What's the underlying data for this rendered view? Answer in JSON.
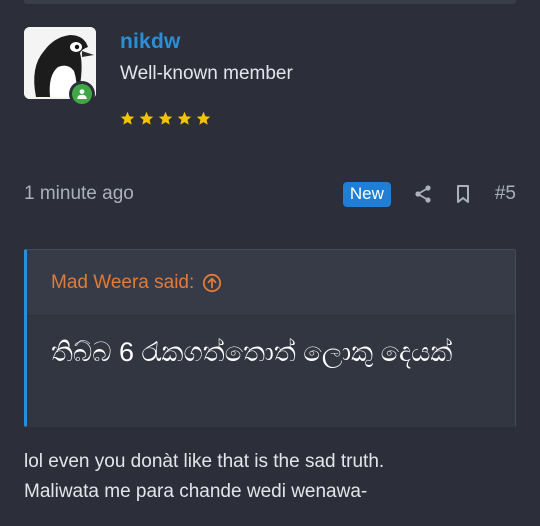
{
  "post": {
    "username": "nikdw",
    "user_title": "Well-known member",
    "star_count": 5,
    "timestamp": "1 minute ago",
    "new_badge": "New",
    "post_number": "#5",
    "quote_author": "Mad Weera said:",
    "quote_text": "තිබ්බ 6 රැකගත්තොත් ලොකු දෙයක්",
    "message_line1": "lol even you donàt like that is the sad truth.",
    "message_line2": "Maliwata me para chande wedi wenawa-"
  },
  "icons": {
    "avatar": "penguin-avatar",
    "online": "user-online-icon",
    "share": "share-icon",
    "bookmark": "bookmark-icon",
    "quote_jump": "arrow-up-circle-icon",
    "star": "star-icon"
  },
  "colors": {
    "background": "#2c2f3a",
    "username": "#2a8fd6",
    "new_badge": "#1f7fd6",
    "quote_author": "#e07b3a",
    "online": "#3fa845",
    "stars": "#f5c400"
  }
}
